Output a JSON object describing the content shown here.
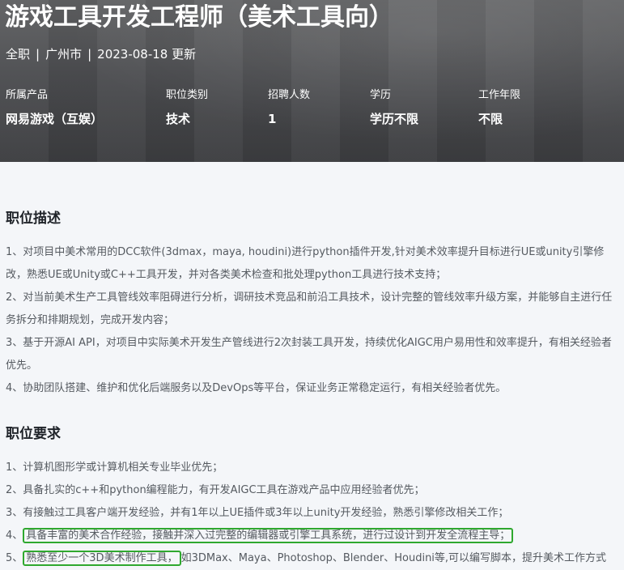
{
  "job": {
    "title": "游戏工具开发工程师（美术工具向）",
    "meta": {
      "type": "全职",
      "location": "广州市",
      "updated": "2023-08-18 更新",
      "separator": "|"
    },
    "info": [
      {
        "label": "所属产品",
        "value": "网易游戏（互娱）"
      },
      {
        "label": "职位类别",
        "value": "技术"
      },
      {
        "label": "招聘人数",
        "value": "1"
      },
      {
        "label": "学历",
        "value": "学历不限"
      },
      {
        "label": "工作年限",
        "value": "不限"
      }
    ]
  },
  "description": {
    "heading": "职位描述",
    "items": [
      "1、对项目中美术常用的DCC软件(3dmax，maya, houdini)进行python插件开发,针对美术效率提升目标进行UE或unity引擎修改，熟悉UE或Unity或C++工具开发，并对各类美术检查和批处理python工具进行技术支持；",
      "2、对当前美术生产工具管线效率阻碍进行分析，调研技术竞品和前沿工具技术，设计完整的管线效率升级方案，并能够自主进行任务拆分和排期规划，完成开发内容；",
      "3、基于开源AI API，对项目中实际美术开发生产管线进行2次封装工具开发，持续优化AIGC用户易用性和效率提升，有相关经验者优先。",
      "4、协助团队搭建、维护和优化后端服务以及DevOps等平台，保证业务正常稳定运行，有相关经验者优先。"
    ]
  },
  "requirements": {
    "heading": "职位要求",
    "item1": "1、计算机图形学或计算机相关专业毕业优先；",
    "item2": "2、具备扎实的c++和python编程能力，有开发AIGC工具在游戏产品中应用经验者优先；",
    "item3": "3、有接触过工具客户端开发经验，并有1年以上UE插件或3年以上unity开发经验，熟悉引擎修改相关工作；",
    "item4": {
      "prefix": "4、",
      "highlight": "具备丰富的美术合作经验，接触并深入过完整的编辑器或引擎工具系统，进行过设计到开发全流程主导；"
    },
    "item5": {
      "prefix": "5、",
      "highlight": "熟悉至少一个3D美术制作工具，",
      "rest": "如3DMax、Maya、Photoshop、Blender、Houdini等,可以编写脚本，提升美术工作方式"
    }
  },
  "colors": {
    "highlight_border": "#2fa82f",
    "heading_text": "#1f2329",
    "body_text": "#555a60",
    "page_background": "#f4f6f9"
  }
}
